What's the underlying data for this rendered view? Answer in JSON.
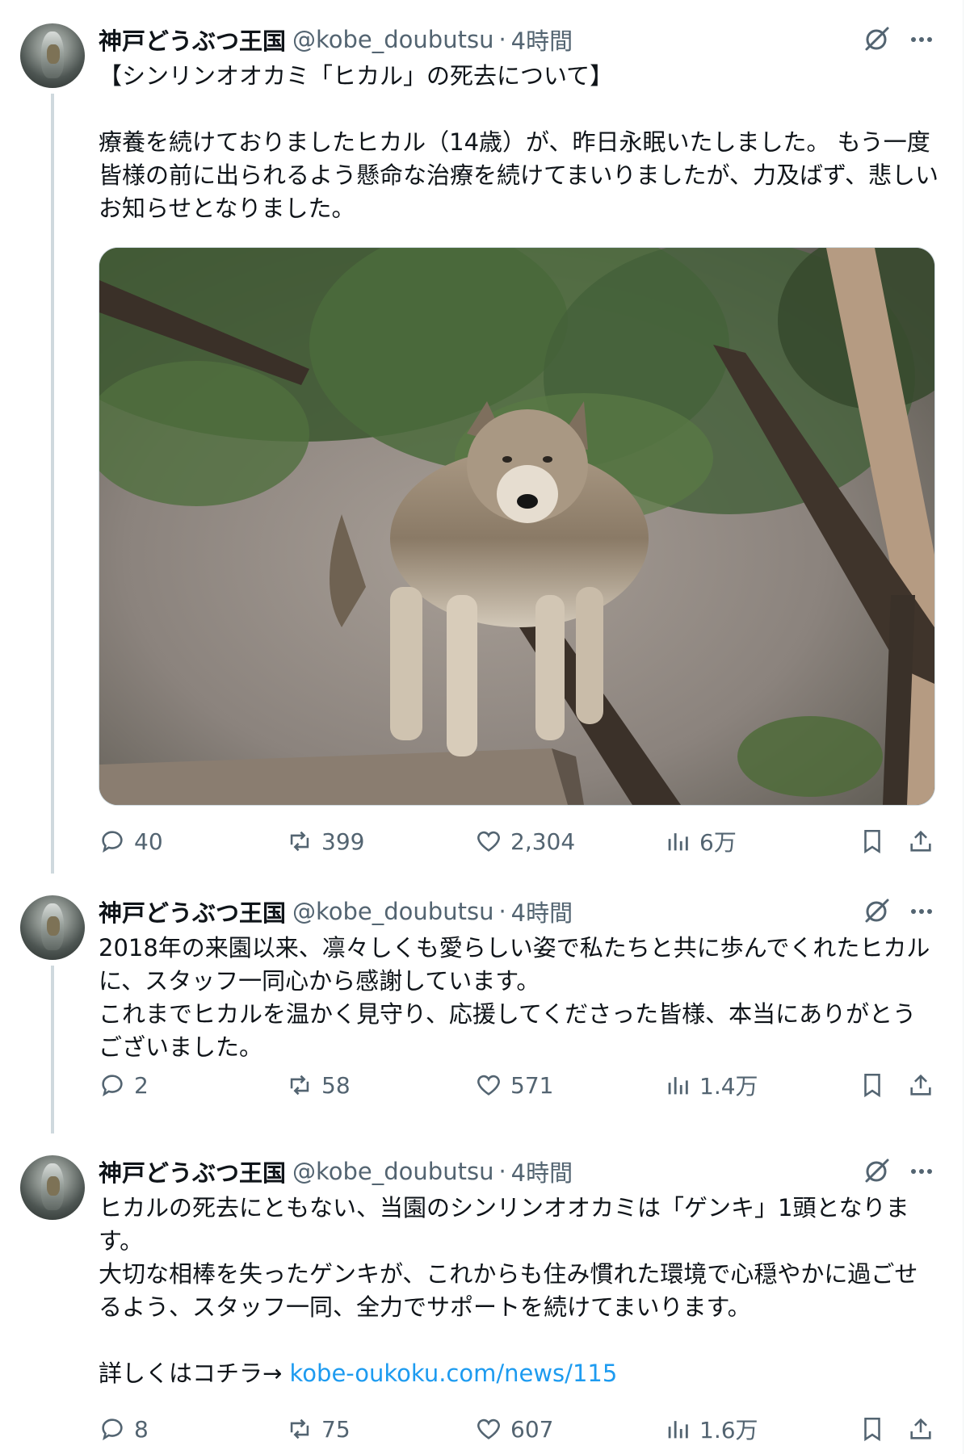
{
  "tweets": [
    {
      "name": "神戸どうぶつ王国",
      "handle": "@kobe_doubutsu",
      "sep": "·",
      "time": "4時間",
      "text": "【シンリンオオカミ「ヒカル」の死去について】\n\n療養を続けておりましたヒカル（14歳）が、昨日永眠いたしました。 もう一度皆様の前に出られるよう懸命な治療を続けてまいりましたが、力及ばず、悲しいお知らせとなりました。",
      "has_media": true,
      "metrics": {
        "replies": "40",
        "reposts": "399",
        "likes": "2,304",
        "views": "6万"
      }
    },
    {
      "name": "神戸どうぶつ王国",
      "handle": "@kobe_doubutsu",
      "sep": "·",
      "time": "4時間",
      "text": "2018年の来園以来、凛々しくも愛らしい姿で私たちと共に歩んでくれたヒカルに、スタッフ一同心から感謝しています。\nこれまでヒカルを温かく見守り、応援してくださった皆様、本当にありがとうございました。",
      "metrics": {
        "replies": "2",
        "reposts": "58",
        "likes": "571",
        "views": "1.4万"
      }
    },
    {
      "name": "神戸どうぶつ王国",
      "handle": "@kobe_doubutsu",
      "sep": "·",
      "time": "4時間",
      "text": "ヒカルの死去にともない、当園のシンリンオオカミは「ゲンキ」1頭となります。\n大切な相棒を失ったゲンキが、これからも住み慣れた環境で心穏やかに過ごせるよう、スタッフ一同、全力でサポートを続けてまいります。\n\n詳しくはコチラ→ ",
      "link": "kobe-oukoku.com/news/115",
      "metrics": {
        "replies": "8",
        "reposts": "75",
        "likes": "607",
        "views": "1.6万"
      }
    }
  ],
  "icons": {
    "reply": "reply-icon",
    "repost": "repost-icon",
    "like": "like-icon",
    "views": "views-icon",
    "bookmark": "bookmark-icon",
    "share": "share-icon",
    "grok": "grok-icon",
    "more": "more-icon"
  },
  "colors": {
    "text": "#0f1419",
    "secondary": "#536471",
    "link": "#1d9bf0",
    "thread_line": "#cfd9de"
  }
}
